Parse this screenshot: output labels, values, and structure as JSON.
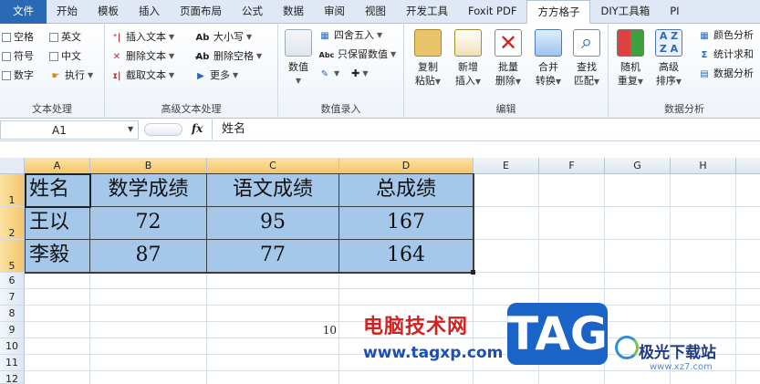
{
  "tabs": [
    "文件",
    "开始",
    "模板",
    "插入",
    "页面布局",
    "公式",
    "数据",
    "审阅",
    "视图",
    "开发工具",
    "Foxit PDF",
    "方方格子",
    "DIY工具箱",
    "PI"
  ],
  "ribbon": {
    "text_processing": {
      "label": "文本处理",
      "items": [
        "空格",
        "英文",
        "符号",
        "中文",
        "数字",
        "执行"
      ]
    },
    "advanced_text": {
      "label": "高级文本处理",
      "items": [
        "插入文本",
        "删除文本",
        "截取文本",
        "大小写",
        "删除空格",
        "更多"
      ]
    },
    "value_entry": {
      "label": "数值录入",
      "big": "数值",
      "items": [
        "四舍五入",
        "只保留数值"
      ]
    },
    "edit": {
      "label": "编辑",
      "buttons": [
        {
          "l1": "复制",
          "l2": "粘贴"
        },
        {
          "l1": "新增",
          "l2": "插入"
        },
        {
          "l1": "批量",
          "l2": "删除"
        },
        {
          "l1": "合并",
          "l2": "转换"
        },
        {
          "l1": "查找",
          "l2": "匹配"
        }
      ]
    },
    "data_analysis": {
      "label": "数据分析",
      "buttons": [
        {
          "l1": "随机",
          "l2": "重复"
        },
        {
          "l1": "高级",
          "l2": "排序"
        }
      ],
      "items": [
        "颜色分析",
        "统计求和",
        "数据分析"
      ]
    }
  },
  "formula_bar": {
    "name_box": "A1",
    "fx": "fx",
    "content": "姓名"
  },
  "columns": [
    "A",
    "B",
    "C",
    "D",
    "E",
    "F",
    "G",
    "H"
  ],
  "rows": [
    "1",
    "2",
    "5",
    "6",
    "7",
    "8",
    "9",
    "10",
    "11",
    "12"
  ],
  "table": [
    [
      "姓名",
      "数学成绩",
      "语文成绩",
      "总成绩"
    ],
    [
      "王以",
      "72",
      "95",
      "167"
    ],
    [
      "李毅",
      "87",
      "77",
      "164"
    ]
  ],
  "stray_value": "10",
  "watermark": {
    "cn": "电脑技术网",
    "url": "www.tagxp.com",
    "tag": "TAG",
    "site_cn": "极光下载站",
    "site_url": "www.xz7.com"
  },
  "colors": {
    "selection_fill": "#a5c8ea",
    "header_highlight": "#f5c56b",
    "file_tab": "#2a6ab4"
  }
}
